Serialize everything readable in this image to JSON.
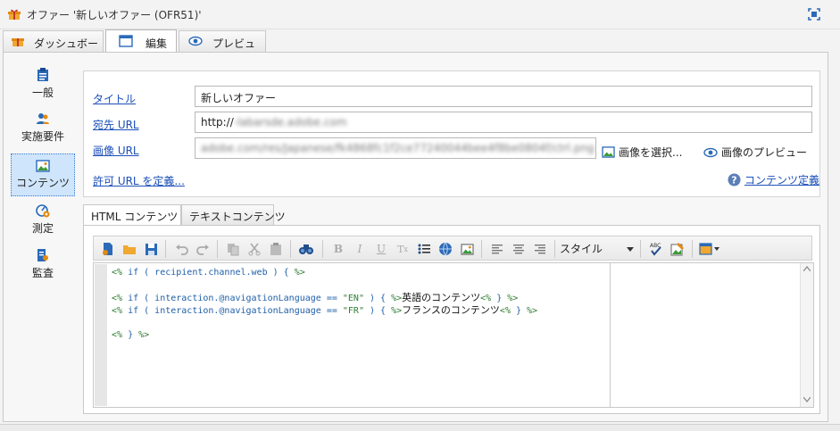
{
  "window": {
    "title": "オファー '新しいオファー (OFR51)'"
  },
  "top_tabs": [
    {
      "label": "ダッシュボード"
    },
    {
      "label": "編集"
    },
    {
      "label": "プレビュー"
    }
  ],
  "sidebar": {
    "items": [
      {
        "label": "一般"
      },
      {
        "label": "実施要件"
      },
      {
        "label": "コンテンツ"
      },
      {
        "label": "測定"
      },
      {
        "label": "監査"
      }
    ]
  },
  "form": {
    "title_label": "タイトル",
    "title_value": "新しいオファー",
    "dest_url_label": "宛先 URL",
    "dest_url_value": "http://",
    "dest_url_blurred": "-labarsde.adobe.com",
    "image_url_label": "画像 URL",
    "image_url_blurred": "adobe.com/res/Japanese/fk4868fc1f2ce77240044bee4f8be0804f/ctrl.png",
    "select_image_label": "画像を選択...",
    "preview_image_label": "画像のプレビュー",
    "allowed_url_label": "許可 URL を定義...",
    "content_def_label": "コンテンツ定義"
  },
  "editor_tabs": [
    {
      "label": "HTML コンテンツ"
    },
    {
      "label": "テキストコンテンツ"
    }
  ],
  "toolbar": {
    "style_label": "スタイル"
  },
  "code": {
    "line1": {
      "tag_open": "<%",
      "kw": " if ( recipient.channel.web ) {",
      "tag_close": " %>"
    },
    "line3": {
      "tag_open": "<%",
      "kw": " if ( interaction.@navigationLanguage == ",
      "str": "\"EN\"",
      "kw2": " ) {",
      "tag_close": " %>",
      "text": "英語のコンテンツ",
      "tag_open2": "<%",
      "kw3": " }",
      "tag_close2": " %>"
    },
    "line4": {
      "tag_open": "<%",
      "kw": " if ( interaction.@navigationLanguage == ",
      "str": "\"FR\"",
      "kw2": " ) {",
      "tag_close": " %>",
      "text": "フランスのコンテンツ",
      "tag_open2": "<%",
      "kw3": " }",
      "tag_close2": " %>"
    },
    "line6": {
      "tag_open": "<%",
      "kw": " }",
      "tag_close": " %>"
    }
  },
  "colors": {
    "link": "#1b4fb8",
    "active_nav": "#cfe5fb",
    "code_tag": "#2e7d32",
    "code_keyword": "#1f5fa8"
  }
}
